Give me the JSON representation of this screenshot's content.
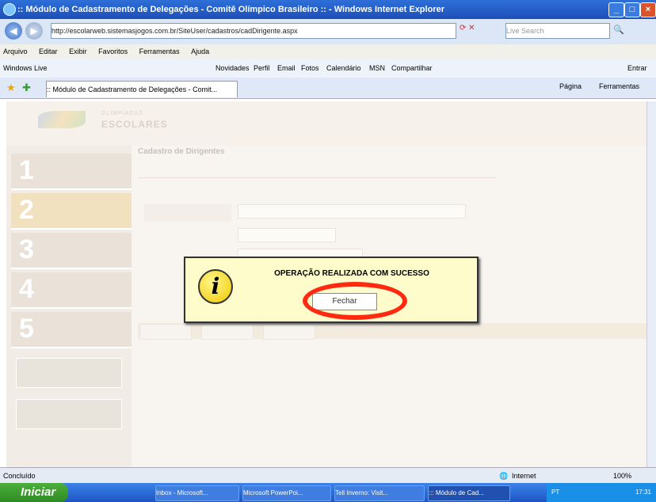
{
  "window": {
    "title": ":: Módulo de Cadastramento de Delegações - Comitê Olímpico Brasileiro :: - Windows Internet Explorer",
    "address": "http://escolarweb.sistemasjogos.com.br/SiteUser/cadastros/cadDirigente.aspx",
    "search_placeholder": "Live Search"
  },
  "menu": [
    "Arquivo",
    "Editar",
    "Exibir",
    "Favoritos",
    "Ferramentas",
    "Ajuda"
  ],
  "links": [
    "Windows Live",
    "Novidades",
    "Perfil",
    "Email",
    "Fotos",
    "Calendário",
    "MSN",
    "Compartilhar",
    "Entrar"
  ],
  "tab": {
    "label": ":: Módulo de Cadastramento de Delegações - Comit..."
  },
  "commandbar": {
    "page": "Página",
    "tools": "Ferramentas"
  },
  "page": {
    "logo_small": "OLIMPÍADAS",
    "logo_big": "ESCOLARES",
    "section_title": "Cadastro de Dirigentes",
    "steps": [
      "1",
      "2",
      "3",
      "4",
      "5"
    ]
  },
  "dialog": {
    "message": "OPERAÇÃO REALIZADA COM SUCESSO",
    "button": "Fechar",
    "icon": "info-icon"
  },
  "status": {
    "left": "Concluído",
    "zone": "Internet",
    "zoom": "100%"
  },
  "taskbar": {
    "start": "Iniciar",
    "items": [
      "Inbox - Microsoft...",
      "Microsoft PowerPoi...",
      "Tell Inverno: Visit...",
      "::: Módulo de Cad..."
    ],
    "clock": "17:31",
    "lang": "PT"
  },
  "colors": {
    "highlight": "#ff2a10",
    "dialog_bg": "#fffccc",
    "titlebar": "#2f6fd8"
  }
}
